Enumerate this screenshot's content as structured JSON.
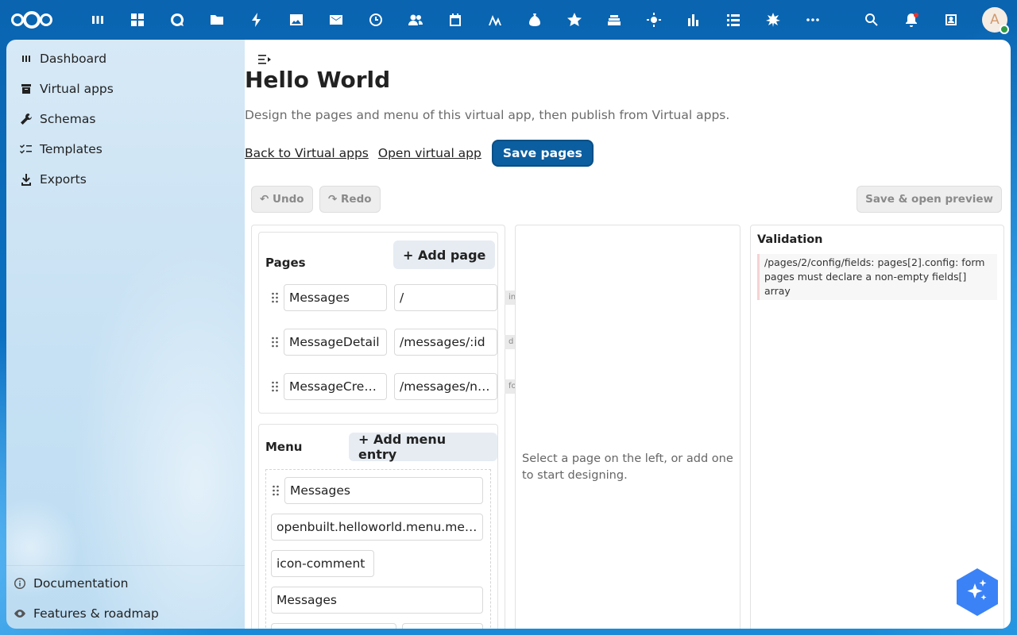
{
  "topbar": {
    "apps": [
      "dashboard",
      "apps",
      "talk",
      "files",
      "activity",
      "photos",
      "mail",
      "deck",
      "contacts",
      "calendar",
      "analytics",
      "finance",
      "favorites",
      "collectives",
      "settings",
      "stats",
      "tasks",
      "openbuilt",
      "more"
    ],
    "right": [
      "search-icon",
      "notifications-icon",
      "contacts-menu-icon"
    ],
    "avatar_letter": "A"
  },
  "sidebar": {
    "items": [
      {
        "label": "Dashboard",
        "icon": "dashboard-icon"
      },
      {
        "label": "Virtual apps",
        "icon": "archive-icon"
      },
      {
        "label": "Schemas",
        "icon": "wrench-icon"
      },
      {
        "label": "Templates",
        "icon": "checklist-icon"
      },
      {
        "label": "Exports",
        "icon": "download-icon"
      }
    ],
    "footer": [
      {
        "label": "Documentation",
        "icon": "info-icon"
      },
      {
        "label": "Features & roadmap",
        "icon": "eye-icon"
      }
    ]
  },
  "main": {
    "title": "Hello World",
    "subtitle": "Design the pages and menu of this virtual app, then publish from Virtual apps.",
    "back_link": "Back to Virtual apps",
    "open_link": "Open virtual app",
    "save_button": "Save pages",
    "undo": "↶ Undo",
    "redo": "↷ Redo",
    "preview": "Save & open preview"
  },
  "pages": {
    "title": "Pages",
    "add_button": "+ Add page",
    "rows": [
      {
        "name": "Messages",
        "route": "/",
        "type_tag": "in"
      },
      {
        "name": "MessageDetail",
        "route": "/messages/:id",
        "type_tag": "d"
      },
      {
        "name": "MessageCreate",
        "route": "/messages/new",
        "type_tag": "fo"
      }
    ]
  },
  "menu": {
    "title": "Menu",
    "add_button": "+ Add menu entry",
    "entry": {
      "label": "Messages",
      "i18n_key": "openbuilt.helloworld.menu.messages",
      "icon": "icon-comment",
      "page": "Messages"
    }
  },
  "designer": {
    "empty": "Select a page on the left, or add one to start designing."
  },
  "validation": {
    "title": "Validation",
    "messages": [
      "/pages/2/config/fields: pages[2].config: form pages must declare a non-empty fields[] array"
    ]
  },
  "colors": {
    "primary": "#0b5e9f",
    "topbar": "#0a64b0",
    "assistant": "#3b82f6"
  }
}
